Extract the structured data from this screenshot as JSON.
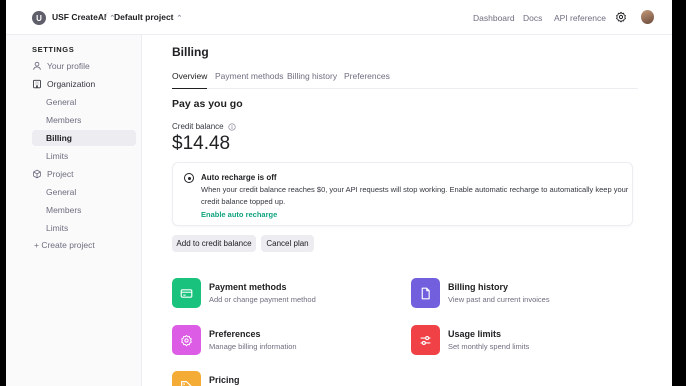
{
  "topbar": {
    "org_initial": "U",
    "org_name": "USF CreateAI",
    "separator": "/",
    "project_name": "Default project",
    "links": [
      "Dashboard",
      "Docs",
      "API reference"
    ]
  },
  "sidebar": {
    "heading": "SETTINGS",
    "items": [
      {
        "label": "Your profile",
        "icon": "person-icon"
      },
      {
        "label": "Organization",
        "icon": "building-icon"
      },
      {
        "label": "General"
      },
      {
        "label": "Members"
      },
      {
        "label": "Billing"
      },
      {
        "label": "Limits"
      },
      {
        "label": "Project",
        "icon": "box-icon"
      },
      {
        "label": "General"
      },
      {
        "label": "Members"
      },
      {
        "label": "Limits"
      },
      {
        "label": "+ Create project"
      }
    ],
    "active_item": "Billing"
  },
  "main": {
    "title": "Billing",
    "tabs": [
      "Overview",
      "Payment methods",
      "Billing history",
      "Preferences"
    ],
    "active_tab": "Overview",
    "section_title": "Pay as you go",
    "credit_label": "Credit balance",
    "credit_value": "$14.48",
    "auto_recharge": {
      "title": "Auto recharge is off",
      "text": "When your credit balance reaches $0, your API requests will stop working. Enable automatic recharge to automatically keep your credit balance topped up.",
      "link": "Enable auto recharge"
    },
    "buttons": {
      "add_credit": "Add to credit balance",
      "cancel_plan": "Cancel plan"
    },
    "tiles": [
      {
        "title": "Payment methods",
        "desc": "Add or change payment method",
        "icon": "card-icon",
        "color": "#19c37d"
      },
      {
        "title": "Billing history",
        "desc": "View past and current invoices",
        "icon": "document-icon",
        "color": "#715fde"
      },
      {
        "title": "Preferences",
        "desc": "Manage billing information",
        "icon": "settings-icon",
        "color": "#dd5ce5"
      },
      {
        "title": "Usage limits",
        "desc": "Set monthly spend limits",
        "icon": "sliders-icon",
        "color": "#ef4146"
      },
      {
        "title": "Pricing",
        "desc": "",
        "icon": "tag-icon",
        "color": "#f4ac36"
      }
    ]
  },
  "colors": {
    "accent_green": "#10a37f",
    "text_primary": "#202123",
    "text_secondary": "#6e6e80"
  }
}
